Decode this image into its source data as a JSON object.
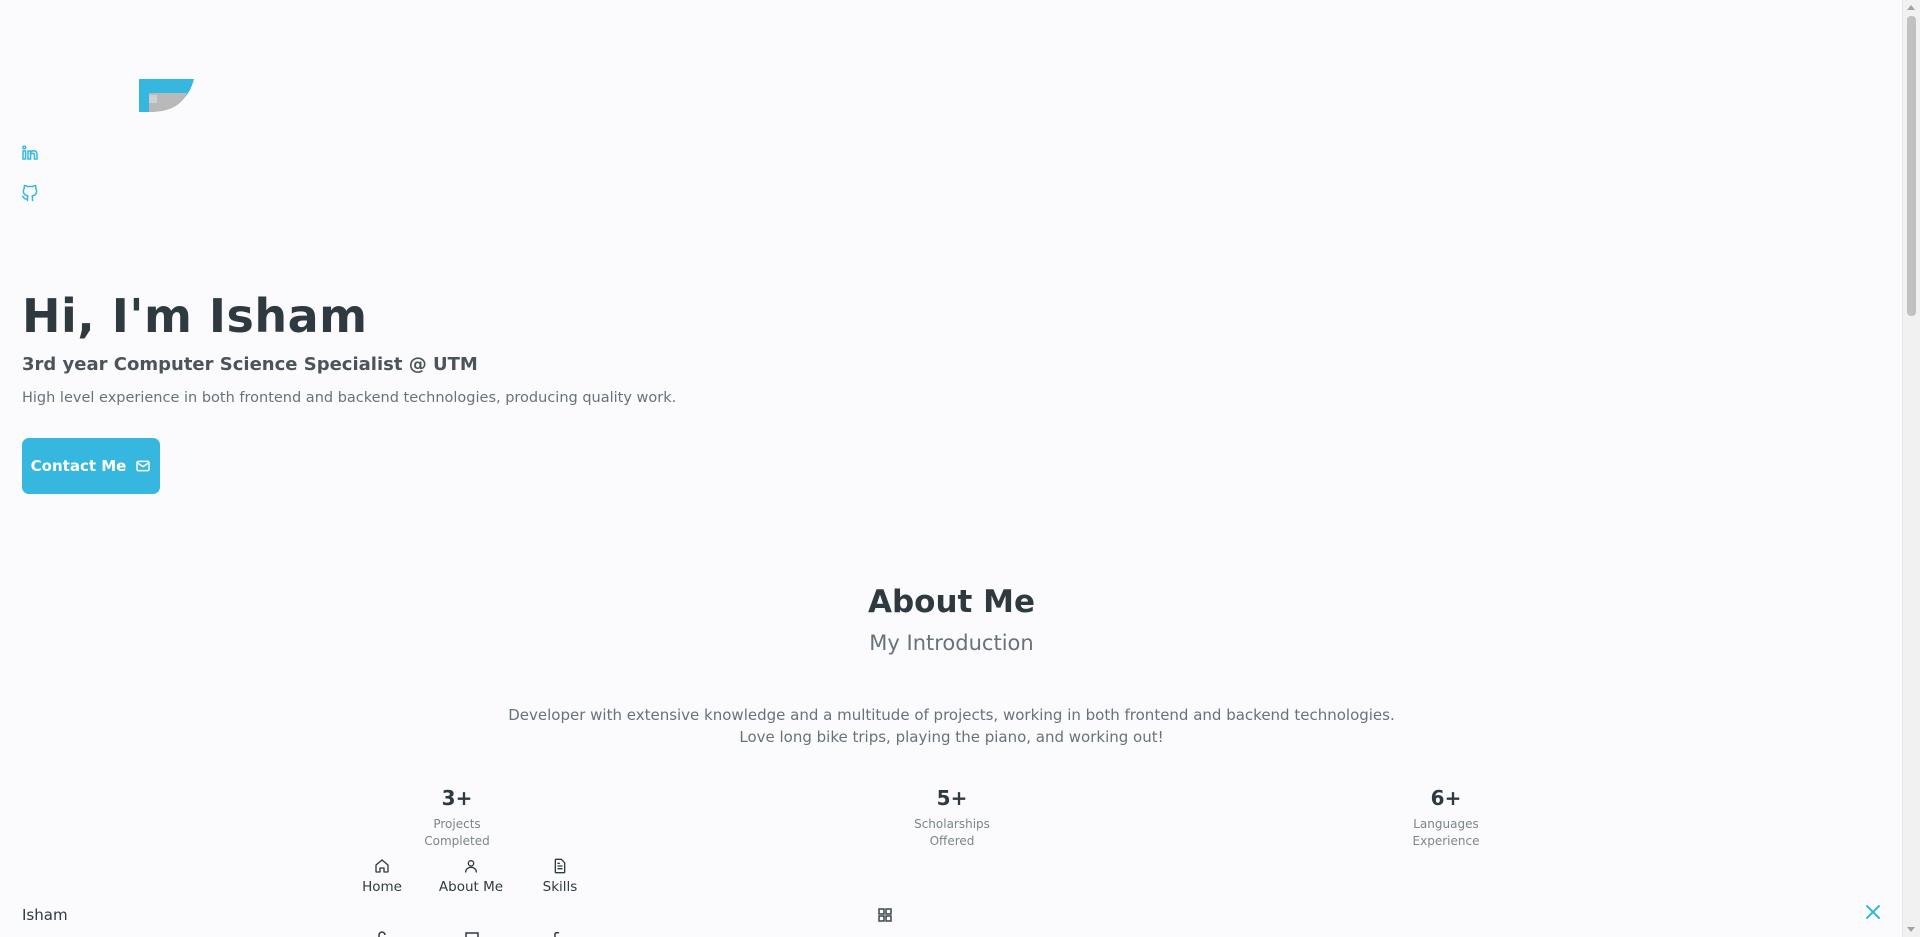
{
  "hero": {
    "title": "Hi, I'm Isham",
    "subtitle": "3rd year Computer Science Specialist @ UTM",
    "description": "High level experience in both frontend and backend technologies, producing quality work.",
    "contact_button": "Contact Me",
    "social": [
      "linkedin-icon",
      "github-icon"
    ],
    "blob_image": "profile-image-blob"
  },
  "about": {
    "title": "About Me",
    "subtitle": "My Introduction",
    "description_line1": "Developer with extensive knowledge and a multitude of projects, working in both frontend and backend technologies.",
    "description_line2": "Love long bike trips, playing the piano, and working out!",
    "stats": [
      {
        "number": "3+",
        "label_line1": "Projects",
        "label_line2": "Completed"
      },
      {
        "number": "5+",
        "label_line1": "Scholarships",
        "label_line2": "Offered"
      },
      {
        "number": "6+",
        "label_line1": "Languages",
        "label_line2": "Experience"
      }
    ]
  },
  "nav": {
    "logo": "Isham",
    "items": [
      {
        "label": "Home",
        "icon": "home-icon"
      },
      {
        "label": "About Me",
        "icon": "user-icon"
      },
      {
        "label": "Skills",
        "icon": "file-icon"
      }
    ],
    "toggle_icon": "apps-grid-icon",
    "close_icon": "close-icon"
  },
  "colors": {
    "accent": "#36b7e0",
    "title": "#2f3a40",
    "text": "#687379",
    "background": "#fbfbfe"
  }
}
